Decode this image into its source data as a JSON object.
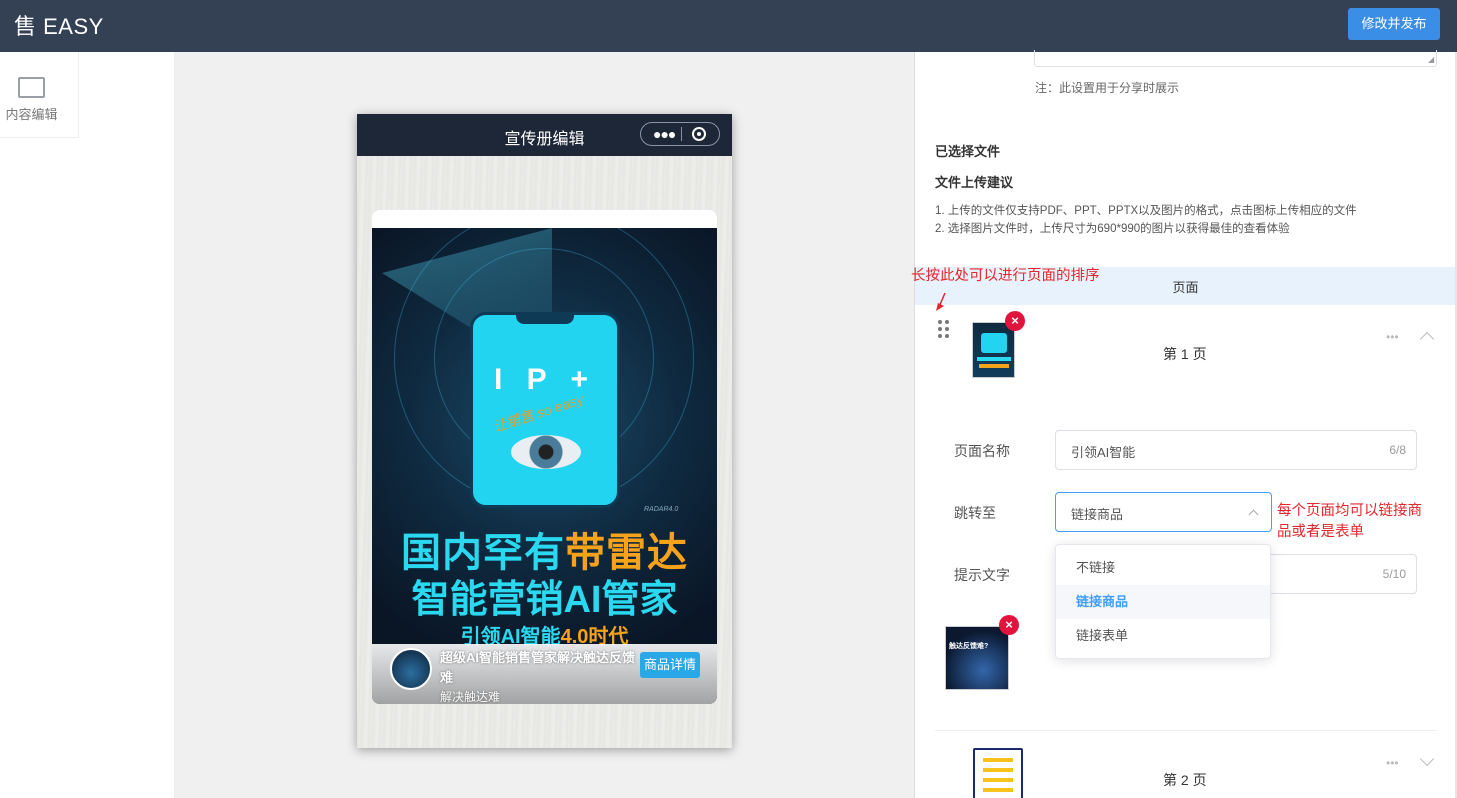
{
  "header": {
    "logo": "售 EASY",
    "publish_label": "修改并发布"
  },
  "leftnav": {
    "items": [
      {
        "label": "内容编辑",
        "icon": "frame-icon"
      }
    ]
  },
  "phone": {
    "title": "宣传册编辑",
    "poster": {
      "ip_text": "I P +",
      "script_text": "让销售 so easy",
      "radar_text": "RADAR4.0",
      "line1_a": "国内罕有",
      "line1_b": "带雷达",
      "line2": "智能营销AI管家",
      "line3_a": "引领AI智能",
      "line3_b": "4.0时代"
    },
    "overlay": {
      "title": "超级AI智能销售管家解决触达反馈难",
      "subtitle": "解决触达难",
      "button": "商品详情"
    }
  },
  "panel": {
    "share_note": "注：此设置用于分享时展示",
    "selected_file": "已选择文件",
    "advice_title": "文件上传建议",
    "advice_1": "1. 上传的文件仅支持PDF、PPT、PPTX以及图片的格式，点击图标上传相应的文件",
    "advice_2": "2. 选择图片文件时，上传尺寸为690*990的图片以获得最佳的查看体验",
    "pages_header": "页面",
    "pages": [
      {
        "label": "第 1 页"
      },
      {
        "label": "第 2 页"
      }
    ],
    "form": {
      "name_label": "页面名称",
      "name_value": "引领AI智能",
      "name_count": "6/8",
      "jump_label": "跳转至",
      "jump_value": "链接商品",
      "tip_label": "提示文字",
      "tip_count": "5/10"
    },
    "dropdown": {
      "options": [
        "不链接",
        "链接商品",
        "链接表单"
      ],
      "selected": "链接商品"
    },
    "thumb2_text": "触达反馈难?"
  },
  "annotations": {
    "sort_hint": "长按此处可以进行页面的排序",
    "link_hint_1": "每个页面均可以链接商",
    "link_hint_2": "品或者是表单"
  },
  "colors": {
    "header_bg": "#344155",
    "primary": "#409eff",
    "danger": "#e0143c",
    "annotation": "#e5262c",
    "poster_cyan": "#2ad8f0",
    "poster_orange": "#f6a31b"
  }
}
